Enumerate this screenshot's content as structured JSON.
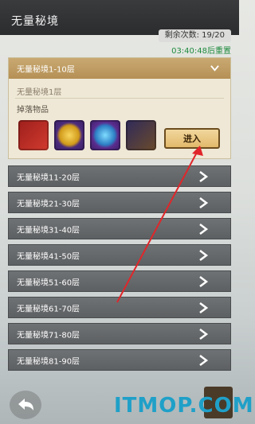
{
  "header": {
    "title": "无量秘境",
    "remaining": "剩余次数: 19/20",
    "reset": "03:40:48后重置"
  },
  "expanded": {
    "label": "无量秘境1-10层",
    "floor": "无量秘境1层",
    "drops_label": "掉落物品",
    "enter_label": "进入"
  },
  "rows": [
    "无量秘境11-20层",
    "无量秘境21-30层",
    "无量秘境31-40层",
    "无量秘境41-50层",
    "无量秘境51-60层",
    "无量秘境61-70层",
    "无量秘境71-80层",
    "无量秘境81-90层"
  ],
  "watermark": "ITMOP.COM"
}
